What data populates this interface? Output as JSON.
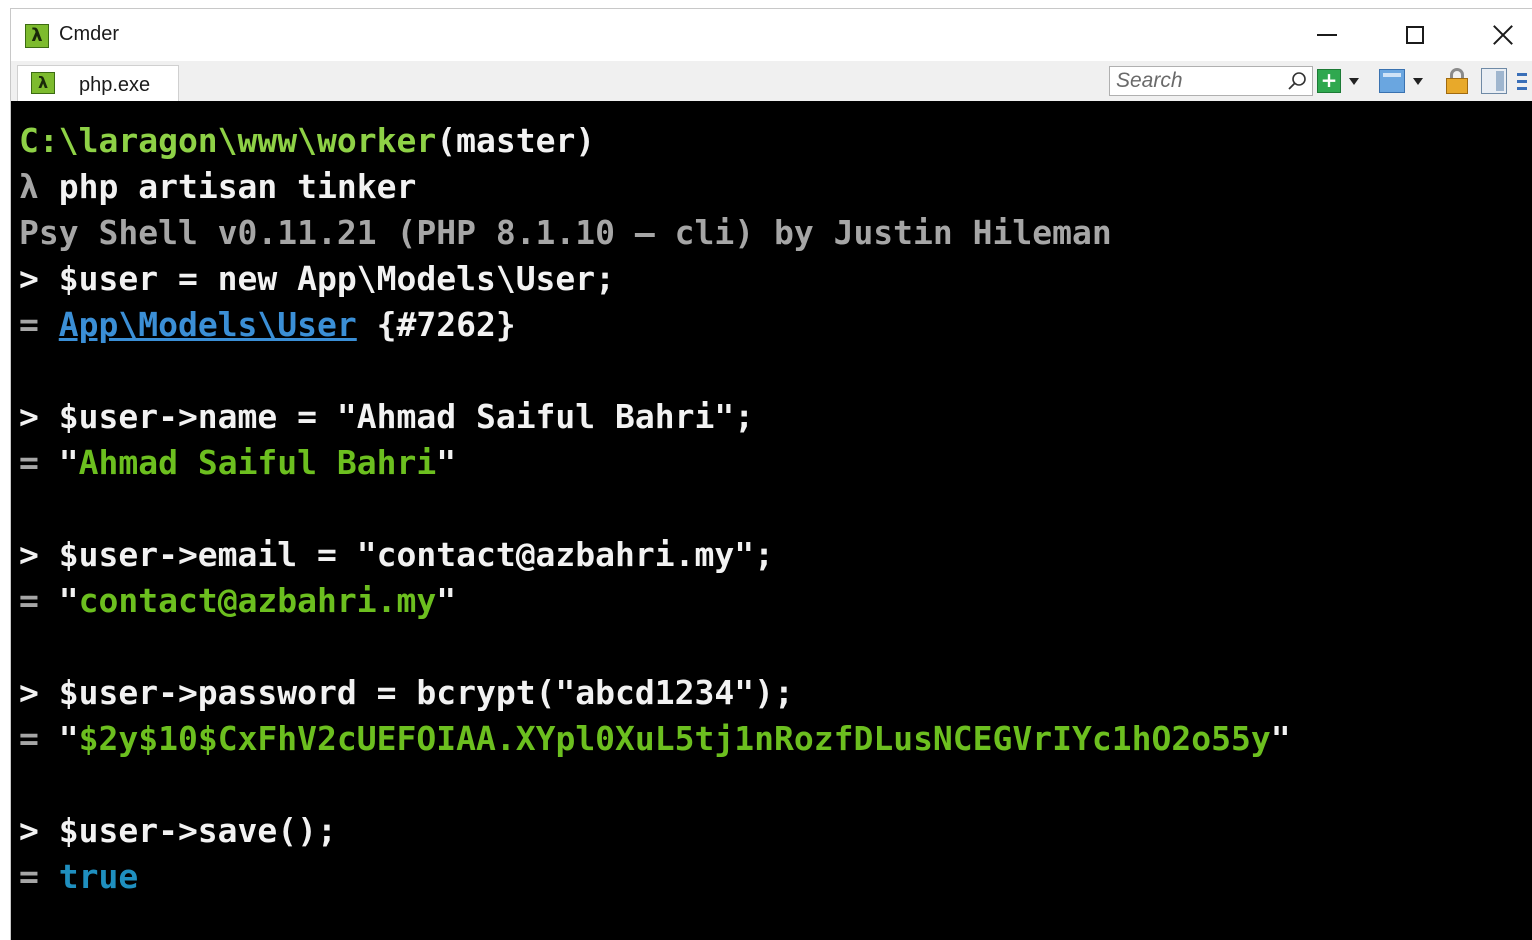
{
  "window": {
    "app_title": "Cmder",
    "app_icon_glyph": "λ"
  },
  "tabbar": {
    "tab_label": "php.exe",
    "tab_icon_glyph": "λ",
    "search_placeholder": "Search"
  },
  "toolbar_icons": [
    "search-icon",
    "new-console-plus-icon",
    "chevron-down-icon",
    "console-icon",
    "chevron-down-icon",
    "lock-icon",
    "panel-icon",
    "menu-icon"
  ],
  "colors": {
    "console_bg": "#000000",
    "path_green": "#8ed146",
    "string_green": "#6cbf1f",
    "link_blue": "#3b8fd6",
    "bool_cyan": "#1f8fbf"
  },
  "console": {
    "prompt_path": "C:\\laragon\\www\\worker",
    "prompt_branch": "(master)",
    "command_prefix": "λ ",
    "command": "php artisan tinker",
    "banner": "Psy Shell v0.11.21 (PHP 8.1.10 — cli) by Justin Hileman",
    "entries": [
      {
        "input": "> $user = new App\\Models\\User;",
        "result_prefix": "= ",
        "result_link": "App\\Models\\User",
        "result_suffix": " {#7262}"
      },
      {
        "input": "> $user->name = \"Ahmad Saiful Bahri\";",
        "result_prefix": "= ",
        "result_quote_open": "\"",
        "result_value": "Ahmad Saiful Bahri",
        "result_quote_close": "\""
      },
      {
        "input": "> $user->email = \"contact@azbahri.my\";",
        "result_prefix": "= ",
        "result_quote_open": "\"",
        "result_value": "contact@azbahri.my",
        "result_quote_close": "\""
      },
      {
        "input": "> $user->password = bcrypt(\"abcd1234\");",
        "result_prefix": "= ",
        "result_quote_open": "\"",
        "result_value": "$2y$10$CxFhV2cUEFOIAA.XYpl0XuL5tj1nRozfDLusNCEGVrIYc1hO2o55y",
        "result_quote_close": "\""
      },
      {
        "input": "> $user->save();",
        "result_prefix": "= ",
        "result_value": "true"
      }
    ]
  }
}
